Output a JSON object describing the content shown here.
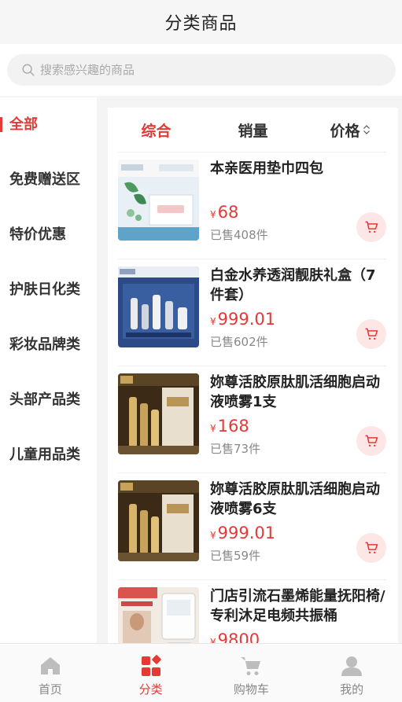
{
  "header": {
    "title": "分类商品"
  },
  "search": {
    "placeholder": "搜索感兴趣的商品"
  },
  "sidebar": {
    "items": [
      {
        "label": "全部",
        "active": true
      },
      {
        "label": "免费赠送区",
        "active": false
      },
      {
        "label": "特价优惠",
        "active": false
      },
      {
        "label": "护肤日化类",
        "active": false
      },
      {
        "label": "彩妆品牌类",
        "active": false
      },
      {
        "label": "头部产品类",
        "active": false
      },
      {
        "label": "儿童用品类",
        "active": false
      }
    ]
  },
  "sort": {
    "comprehensive": "综合",
    "sales": "销量",
    "price": "价格"
  },
  "currency_symbol": "¥",
  "products": [
    {
      "name": "本亲医用垫巾四包",
      "price": "68",
      "sold": "已售408件",
      "image_icon": "pad-package-image"
    },
    {
      "name": "白金水养透润靓肤礼盒（7件套）",
      "price": "999.01",
      "sold": "已售602件",
      "image_icon": "skincare-gift-set-image"
    },
    {
      "name": "妳尊活胶原肽肌活细胞启动液喷雾1支",
      "price": "168",
      "sold": "已售73件",
      "image_icon": "spray-bottle-image"
    },
    {
      "name": "妳尊活胶原肽肌活细胞启动液喷雾6支",
      "price": "999.01",
      "sold": "已售59件",
      "image_icon": "spray-bottle-image"
    },
    {
      "name": "门店引流石墨烯能量抚阳椅/专利沐足电频共振桶",
      "price": "9800",
      "sold": "",
      "image_icon": "chair-foot-bath-image"
    }
  ],
  "tabbar": {
    "items": [
      {
        "label": "首页",
        "icon": "home-icon",
        "active": false
      },
      {
        "label": "分类",
        "icon": "category-icon",
        "active": true
      },
      {
        "label": "购物车",
        "icon": "cart-icon",
        "active": false
      },
      {
        "label": "我的",
        "icon": "user-icon",
        "active": false
      }
    ]
  },
  "colors": {
    "accent": "#e53935",
    "accent_light": "#fde6e6",
    "inactive": "#bdbdbd"
  }
}
